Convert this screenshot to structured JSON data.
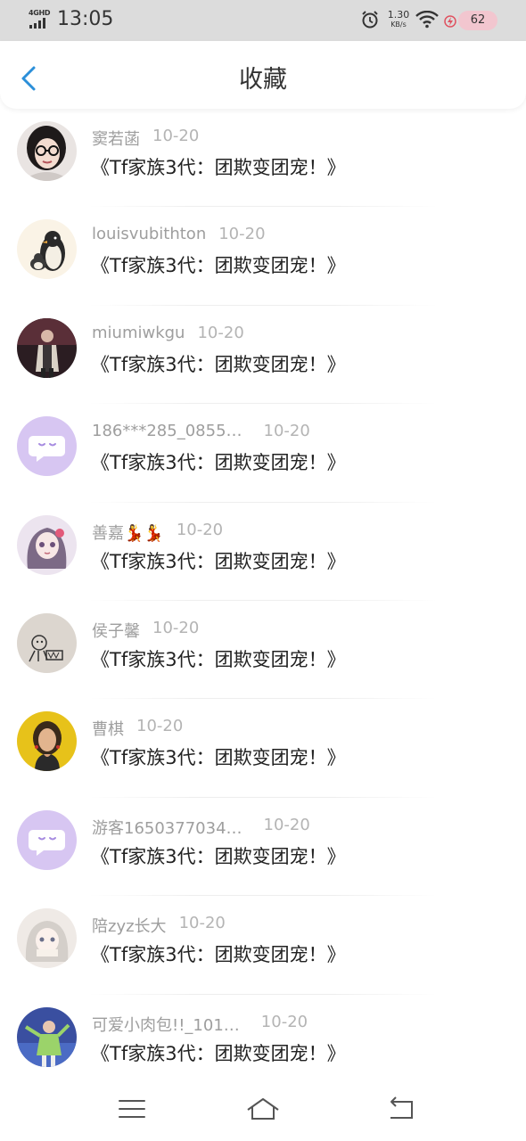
{
  "status_bar": {
    "network": "4GHD",
    "time": "13:05",
    "speed_value": "1.30",
    "speed_unit": "KB/s",
    "battery": "62",
    "icons": [
      "signal-icon",
      "alarm-icon",
      "wifi-icon",
      "charging-icon",
      "battery-icon"
    ]
  },
  "header": {
    "title": "收藏",
    "back_icon": "chevron-left-icon",
    "accent": "#2b8fd9"
  },
  "list": {
    "items": [
      {
        "name": "窦若菡",
        "date": "10-20",
        "title": "《Tf家族3代：团欺变团宠！》",
        "avatar": "photo-avatar-glasses-girl"
      },
      {
        "name": "louisvubithton",
        "date": "10-20",
        "title": "《Tf家族3代：团欺变团宠！》",
        "avatar": "penguin-avatar"
      },
      {
        "name": "miumiwkgu",
        "date": "10-20",
        "title": "《Tf家族3代：团欺变团宠！》",
        "avatar": "photo-avatar-man-street"
      },
      {
        "name": "186***285_0855…",
        "date": "10-20",
        "title": "《Tf家族3代：团欺变团宠！》",
        "avatar": "default-chat-avatar"
      },
      {
        "name": "善嘉💃💃",
        "date": "10-20",
        "title": "《Tf家族3代：团欺变团宠！》",
        "avatar": "anime-girl-avatar"
      },
      {
        "name": "侯子馨",
        "date": "10-20",
        "title": "《Tf家族3代：团欺变团宠！》",
        "avatar": "sketch-avatar"
      },
      {
        "name": "曹棋",
        "date": "10-20",
        "title": "《Tf家族3代：团欺变团宠！》",
        "avatar": "photo-avatar-yellow"
      },
      {
        "name": "游客1650377034…",
        "date": "10-20",
        "title": "《Tf家族3代：团欺变团宠！》",
        "avatar": "default-chat-avatar"
      },
      {
        "name": "陪zyz长大",
        "date": "10-20",
        "title": "《Tf家族3代：团欺变团宠！》",
        "avatar": "anime-silver-hair-avatar"
      },
      {
        "name": "可爱小肉包!!_101…",
        "date": "10-20",
        "title": "《Tf家族3代：团欺变团宠！》",
        "avatar": "photo-avatar-singer"
      }
    ]
  },
  "bottom_nav": {
    "icons": [
      "menu-icon",
      "home-icon",
      "back-icon"
    ]
  }
}
